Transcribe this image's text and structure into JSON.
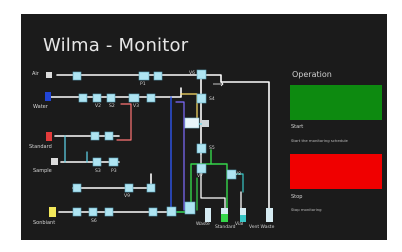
{
  "window": {
    "title": "Wilma - Monitor"
  },
  "sources": {
    "air": "Air",
    "water": "Water",
    "standard": "Standard",
    "sample": "Sample",
    "sonbiant": "Sonbiant"
  },
  "valves": {
    "p1": "P1",
    "v6": "V6",
    "s4": "S4",
    "v2": "V2",
    "s2": "S2",
    "v3": "V3",
    "s5": "S5",
    "s3": "S3",
    "p3": "P3",
    "v7": "V7",
    "v8": "V8",
    "v9": "V9",
    "s6": "S6"
  },
  "outlets": {
    "waste": "Waste",
    "standard": "Standard",
    "vial": "Vial",
    "vent_waste": "Vent Waste"
  },
  "operation": {
    "title": "Operation",
    "start_label": "Start",
    "start_desc": "Start the monitoring schedule",
    "stop_label": "Stop",
    "stop_desc": "Stop monitoring",
    "colors": {
      "start": "#0d8a10",
      "stop": "#f00000"
    }
  }
}
